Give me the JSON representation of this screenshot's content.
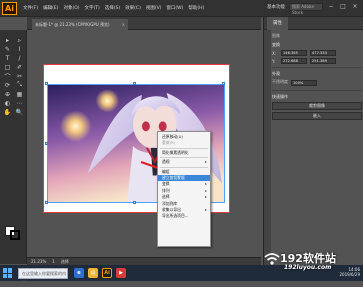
{
  "app": {
    "logo": "Ai",
    "menu": [
      "文件(F)",
      "编辑(E)",
      "对象(O)",
      "文字(T)",
      "选择(S)",
      "效果(C)",
      "视图(V)",
      "窗口(W)",
      "帮助(H)"
    ],
    "workspace": "基本功能",
    "search_placeholder": "搜索 Adobe Stock",
    "window_controls": [
      "−",
      "□",
      "×"
    ]
  },
  "document": {
    "tab_title": "未标题-1* @ 21.23% (CMYK/GPU 预览)",
    "close_glyph": "×"
  },
  "toolbar": {
    "tools": [
      "▸",
      "▹",
      "✎",
      "⌇",
      "T",
      "/",
      "□",
      "✐",
      "⌒",
      "✂",
      "⟳",
      "⤡",
      "⊕",
      "▦",
      "◐",
      "⋯",
      "✋",
      "🔍"
    ]
  },
  "status": {
    "zoom": "21.23%",
    "page": "1",
    "tool": "选择"
  },
  "context_menu": {
    "items": [
      {
        "label": "还原移动(U)",
        "state": "normal"
      },
      {
        "label": "重做(R)",
        "state": "disabled"
      },
      {
        "sep": true
      },
      {
        "label": "简化像素透明化",
        "state": "normal"
      },
      {
        "sep": true
      },
      {
        "label": "透视",
        "state": "normal",
        "arrow": "▸"
      },
      {
        "sep": true
      },
      {
        "label": "编组",
        "state": "normal"
      },
      {
        "label": "建立剪切蒙版",
        "state": "active"
      },
      {
        "label": "变换",
        "state": "normal",
        "arrow": "▸"
      },
      {
        "label": "排列",
        "state": "normal",
        "arrow": "▸"
      },
      {
        "label": "选择",
        "state": "normal",
        "arrow": "▸"
      },
      {
        "label": "添加到库",
        "state": "normal"
      },
      {
        "label": "收集以导出",
        "state": "normal",
        "arrow": "▸"
      },
      {
        "label": "导出所选项目...",
        "state": "normal"
      }
    ]
  },
  "panel": {
    "tab": "属性",
    "section_transform": "变换",
    "section_sub": "图像",
    "x": "X:",
    "x_val": "146.365",
    "w_val": "477.333",
    "y": "Y:",
    "y_val": "272.688",
    "h_val": "251.389",
    "section_appearance": "外观",
    "opacity_label": "不透明度",
    "opacity_val": "100%",
    "section_quick": "快速操作",
    "btn1": "裁剪图像",
    "btn2": "嵌入"
  },
  "taskbar": {
    "search": "在这里输入你要搜索的内容",
    "time": "14:06",
    "date": "2019/6/29"
  },
  "watermark": {
    "main": "192软件站",
    "sub": "192luyou.com"
  },
  "colors": {
    "accent": "#3a86d8",
    "artboard_border": "#e03a3a",
    "arrow": "#e02020"
  }
}
